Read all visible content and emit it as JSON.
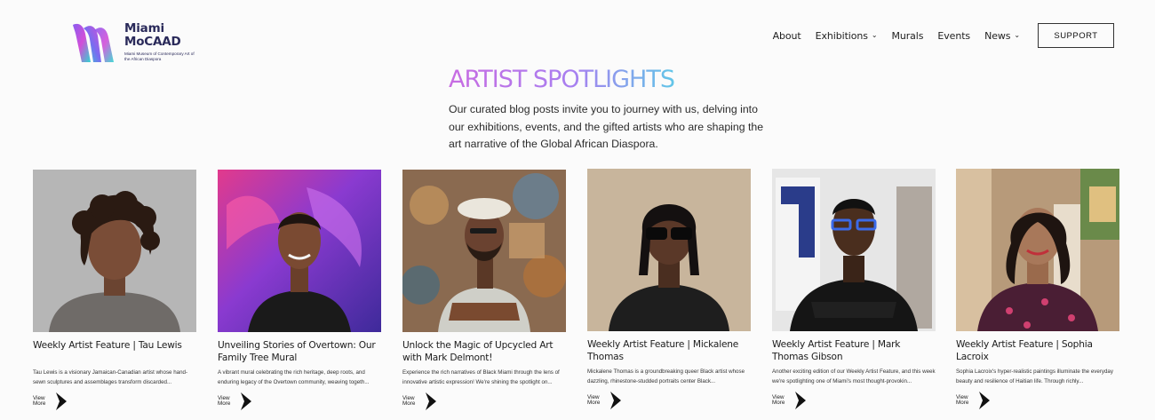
{
  "header": {
    "logo_name_line1": "Miami",
    "logo_name_line2": "MoCAAD",
    "logo_subtitle": "Miami Museum of Contemporary Art of the African Diaspora"
  },
  "nav": {
    "items": [
      "About",
      "Exhibitions",
      "Murals",
      "Events",
      "News"
    ],
    "dropdown_items": [
      "Exhibitions",
      "News"
    ],
    "support_label": "SUPPORT"
  },
  "hero": {
    "title": "ARTIST SPOTLIGHTS",
    "intro": "Our curated blog posts invite you to journey with us, delving into our exhibitions, events, and the gifted artists who are shaping the art narrative of the Global African Diaspora."
  },
  "cards": [
    {
      "title": "Weekly Artist Feature | Tau Lewis",
      "description": "Tau Lewis is a visionary Jamaican-Canadian artist whose hand-sewn sculptures and assemblages transform discarded...",
      "view_more": "View More"
    },
    {
      "title": "Unveiling Stories of Overtown: Our Family Tree Mural",
      "description": "A vibrant mural celebrating the rich heritage, deep roots, and enduring legacy of the Overtown community, weaving togeth...",
      "view_more": "View More"
    },
    {
      "title": "Unlock the Magic of Upcycled Art with Mark Delmont!",
      "description": "Experience the rich narratives of Black Miami through the lens of innovative artistic expression! We're shining the spotlight on...",
      "view_more": "View More"
    },
    {
      "title": "Weekly Artist Feature | Mickalene Thomas",
      "description": "Mickalene Thomas is a groundbreaking queer Black artist whose dazzling, rhinestone-studded portraits center Black...",
      "view_more": "View More"
    },
    {
      "title": "Weekly Artist Feature | Mark Thomas Gibson",
      "description": "Another exciting edition of our Weekly Artist Feature, and this week we're spotlighting one of Miami's most thought-provokin...",
      "view_more": "View More"
    },
    {
      "title": "Weekly Artist Feature | Sophia Lacroix",
      "description": "Sophia Lacroix's hyper-realistic paintings illuminate the everyday beauty and resilience of Haitian life. Through richly...",
      "view_more": "View More"
    }
  ],
  "colors": {
    "title_gradient": [
      "#c86ce2",
      "#a87ff0",
      "#62c6e8"
    ],
    "logo_gradient": [
      "#8a5cf0",
      "#d24fd8",
      "#2fd6d0"
    ]
  },
  "icons": {
    "nav_dropdown": "chevron-down-icon",
    "view_more": "chevron-arrow-right-icon"
  }
}
